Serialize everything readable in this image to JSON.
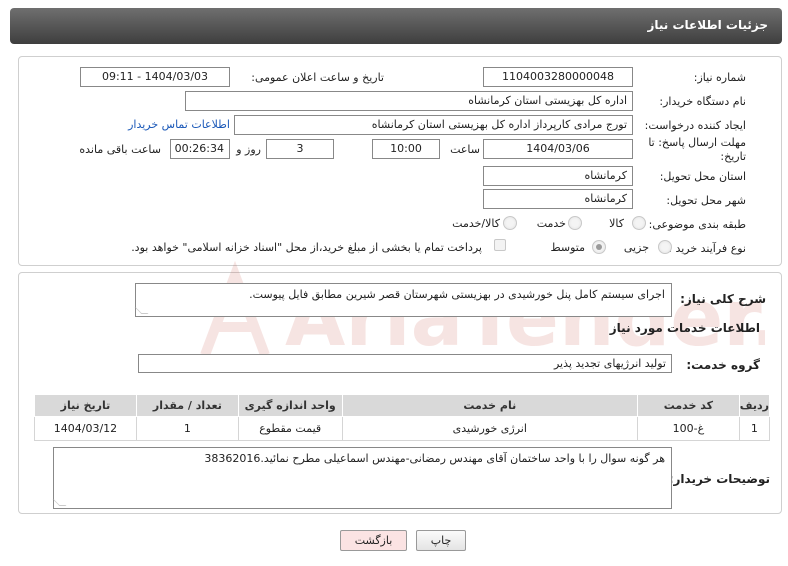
{
  "header": {
    "title": "جزئیات اطلاعات نیاز"
  },
  "form": {
    "need_number": {
      "label": "شماره نیاز:",
      "value": "1104003280000048"
    },
    "announce_datetime": {
      "label": "تاریخ و ساعت اعلان عمومی:",
      "value": "1404/03/03 - 09:11"
    },
    "buyer_org": {
      "label": "نام دستگاه خریدار:",
      "value": "اداره کل بهزیستی استان کرمانشاه"
    },
    "requester": {
      "label": "ایجاد کننده درخواست:",
      "value": "تورج مرادی کارپرداز  اداره کل بهزیستی استان کرمانشاه"
    },
    "contact_link": "اطلاعات تماس خریدار",
    "deadline": {
      "label": "مهلت ارسال پاسخ: تا تاریخ:",
      "date": "1404/03/06",
      "time_label": "ساعت",
      "time": "10:00",
      "days": "3",
      "days_label": "روز و",
      "remaining": "00:26:34",
      "remaining_label": "ساعت باقی مانده"
    },
    "province": {
      "label": "استان محل تحویل:",
      "value": "کرمانشاه"
    },
    "city": {
      "label": "شهر محل تحویل:",
      "value": "کرمانشاه"
    },
    "category": {
      "label": "طبقه بندی موضوعی:",
      "options": [
        "کالا",
        "خدمت",
        "کالا/خدمت"
      ]
    },
    "purchase_type": {
      "label": "نوع فرآیند خرید :",
      "options": [
        "جزیی",
        "متوسط"
      ],
      "selected": "متوسط",
      "payment_note": "پرداخت تمام یا بخشی از مبلغ خرید،از محل \"اسناد خزانه اسلامی\" خواهد بود."
    }
  },
  "summary": {
    "label": "شرح کلی نیاز:",
    "value": "اجرای سیستم کامل پنل خورشیدی در بهزیستی شهرستان قصر شیرین مطابق فایل پیوست."
  },
  "services": {
    "section_title": "اطلاعات خدمات مورد نیاز",
    "group_label": "گروه خدمت:",
    "group_value": "تولید انرژیهای تجدید پذیر",
    "columns": [
      "ردیف",
      "کد خدمت",
      "نام خدمت",
      "واحد اندازه گیری",
      "تعداد / مقدار",
      "تاریخ نیاز"
    ],
    "rows": [
      [
        "1",
        "غ-100",
        "انرژی خورشیدی",
        "قیمت مقطوع",
        "1",
        "1404/03/12"
      ]
    ]
  },
  "buyer_notes": {
    "label": "توضیحات خریدار:",
    "value": "هر گونه سوال را با واحد ساختمان آقای مهندس  رمضانی-مهندس اسماعیلی مطرح نمائید.38362016"
  },
  "buttons": {
    "print": "چاپ",
    "back": "بازگشت"
  },
  "watermark_text": "AriaTender.neT",
  "colors": {
    "header_bg": "#4a4a4a",
    "link": "#1a58b8",
    "back_button_bg": "#fbe3e3",
    "watermark": "#c0392b"
  }
}
